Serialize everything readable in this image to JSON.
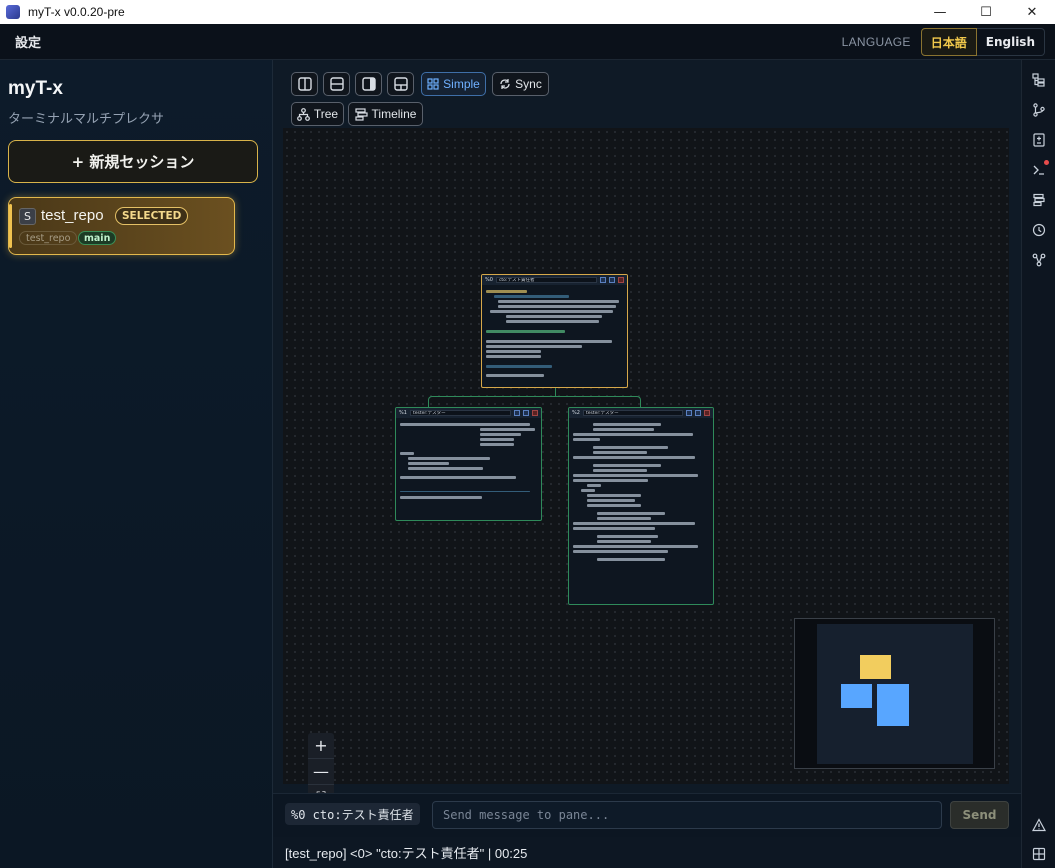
{
  "window": {
    "title": "myT-x v0.0.20-pre",
    "minimize": "—",
    "maximize": "☐",
    "close": "✕"
  },
  "menubar": {
    "settings": "設定",
    "language_label": "LANGUAGE",
    "lang_ja": "日本語",
    "lang_en": "English"
  },
  "sidebar": {
    "brand": "myT-x",
    "subtitle": "ターミナルマルチプレクサ",
    "new_session": "+ 新規セッション",
    "session": {
      "badge": "S",
      "name": "test_repo",
      "status": "SELECTED",
      "repo_tag": "test_repo",
      "branch_tag": "main"
    }
  },
  "toolbar": {
    "simple": "Simple",
    "sync": "Sync",
    "tree": "Tree",
    "timeline": "Timeline"
  },
  "panes": [
    {
      "id": "%0",
      "title": "cto:テスト責任者"
    },
    {
      "id": "%1",
      "title": "tester:テスター"
    },
    {
      "id": "%2",
      "title": "tester:テスター"
    }
  ],
  "zoom": {
    "in": "+",
    "out": "—",
    "fit": "⛶",
    "lock": "🔒"
  },
  "send": {
    "pane_tag": "%0 cto:テスト責任者",
    "placeholder": "Send message to pane...",
    "button": "Send"
  },
  "status": "[test_repo] <0> \"cto:テスト責任者\" | 00:25",
  "colors": {
    "accent": "#f2c94c",
    "pane_border": "#2f8a5a",
    "active": "#6fb0ff"
  }
}
